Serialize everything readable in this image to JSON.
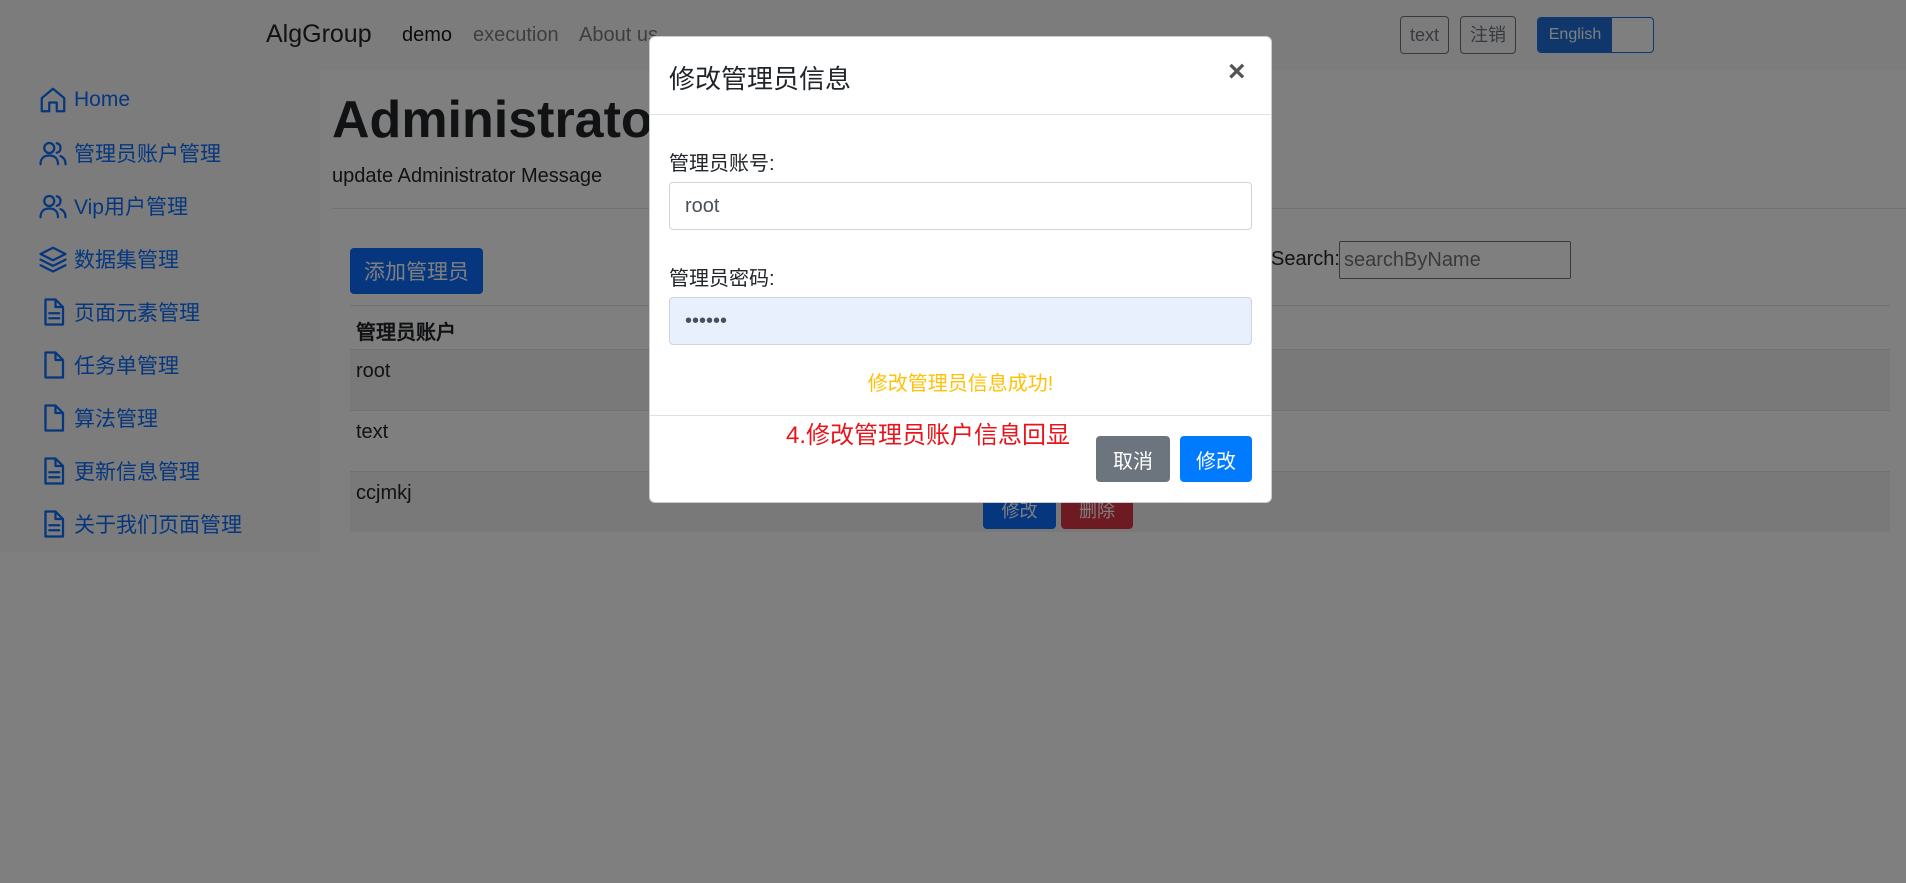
{
  "navbar": {
    "brand": "AlgGroup",
    "links": [
      "demo",
      "execution",
      "About us"
    ],
    "user_button": "text",
    "logout_button": "注销",
    "lang_on": "English"
  },
  "sidebar": {
    "items": [
      {
        "label": "Home",
        "icon": "home-icon"
      },
      {
        "label": "管理员账户管理",
        "icon": "users-icon"
      },
      {
        "label": "Vip用户管理",
        "icon": "users-icon"
      },
      {
        "label": "数据集管理",
        "icon": "layers-icon"
      },
      {
        "label": "页面元素管理",
        "icon": "file-text-icon"
      },
      {
        "label": "任务单管理",
        "icon": "file-icon"
      },
      {
        "label": "算法管理",
        "icon": "file-icon"
      },
      {
        "label": "更新信息管理",
        "icon": "file-text-icon"
      },
      {
        "label": "关于我们页面管理",
        "icon": "file-text-icon"
      }
    ]
  },
  "main": {
    "title": "Administrator",
    "subtitle": "update Administrator Message",
    "add_button": "添加管理员",
    "search_label": "Search:",
    "search_placeholder": "searchByName",
    "table": {
      "header": "管理员账户",
      "rows": [
        "root",
        "text",
        "ccjmkj"
      ],
      "edit_label": "修改",
      "delete_label": "删除"
    }
  },
  "modal": {
    "title": "修改管理员信息",
    "close": "×",
    "account_label": "管理员账号:",
    "account_value": "root",
    "password_label": "管理员密码:",
    "password_value": "••••••",
    "success_message": "修改管理员信息成功!",
    "annotation": "4.修改管理员账户信息回显",
    "cancel_button": "取消",
    "submit_button": "修改"
  },
  "colors": {
    "primary": "#0d6efd",
    "danger": "#dc3545",
    "secondary": "#6c757d",
    "warning": "#ffc107",
    "annotation": "#e8141b"
  }
}
